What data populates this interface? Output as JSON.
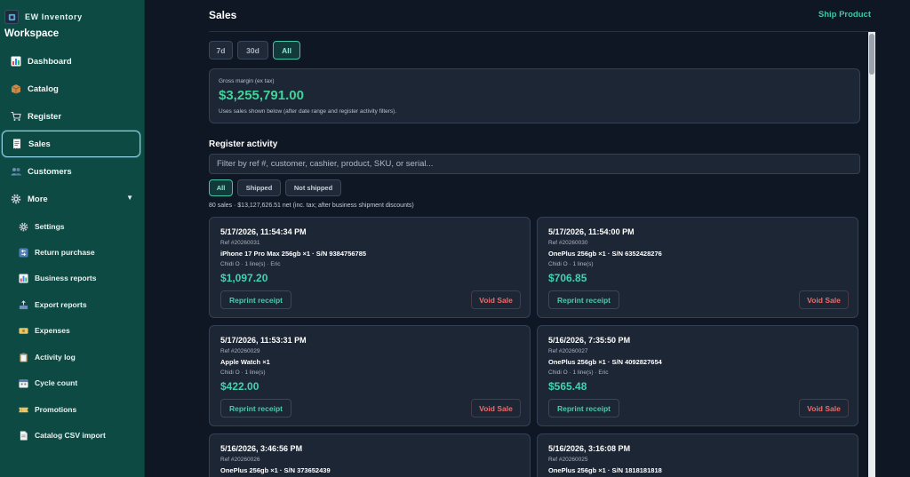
{
  "brand": {
    "name": "EW Inventory",
    "workspace": "Workspace"
  },
  "sidebar": {
    "items": [
      {
        "label": "Dashboard",
        "icon": "chart-icon"
      },
      {
        "label": "Catalog",
        "icon": "box-icon"
      },
      {
        "label": "Register",
        "icon": "cart-icon"
      },
      {
        "label": "Sales",
        "icon": "receipt-icon",
        "active": true
      },
      {
        "label": "Customers",
        "icon": "users-icon"
      },
      {
        "label": "More",
        "icon": "gear-icon",
        "expanded": true
      }
    ],
    "more_items": [
      {
        "label": "Settings",
        "icon": "gear-icon"
      },
      {
        "label": "Return purchase",
        "icon": "return-icon"
      },
      {
        "label": "Business reports",
        "icon": "bar-chart-icon"
      },
      {
        "label": "Export reports",
        "icon": "outbox-icon"
      },
      {
        "label": "Expenses",
        "icon": "money-icon"
      },
      {
        "label": "Activity log",
        "icon": "clipboard-icon"
      },
      {
        "label": "Cycle count",
        "icon": "calendar-icon"
      },
      {
        "label": "Promotions",
        "icon": "ticket-icon"
      },
      {
        "label": "Catalog CSV import",
        "icon": "document-icon"
      }
    ],
    "caret": "▼"
  },
  "header": {
    "title": "Sales",
    "ship_label": "Ship Product"
  },
  "range": {
    "options": [
      "7d",
      "30d",
      "All"
    ],
    "selected": "All"
  },
  "gross_margin": {
    "label": "Gross margin (ex tax)",
    "value": "$3,255,791.00",
    "note": "Uses sales shown below (after date range and register activity filters)."
  },
  "register": {
    "title": "Register activity",
    "filter_placeholder": "Filter by ref #, customer, cashier, product, SKU, or serial...",
    "chips": [
      "All",
      "Shipped",
      "Not shipped"
    ],
    "selected_chip": "All",
    "summary": "80 sales · $13,127,626.51 net (inc. tax; after business shipment discounts)"
  },
  "sales": [
    {
      "datetime": "5/17/2026, 11:54:34 PM",
      "ref": "Ref #20260031",
      "items": "iPhone 17 Pro Max 256gb ×1 · S/N 9384756785",
      "meta": "Chidi O · 1 line(s) · Eric",
      "amount": "$1,097.20",
      "reprint": "Reprint receipt",
      "void": "Void Sale"
    },
    {
      "datetime": "5/17/2026, 11:54:00 PM",
      "ref": "Ref #20260030",
      "items": "OnePlus 256gb ×1 · S/N 6352428276",
      "meta": "Chidi O · 1 line(s)",
      "amount": "$706.85",
      "reprint": "Reprint receipt",
      "void": "Void Sale"
    },
    {
      "datetime": "5/17/2026, 11:53:31 PM",
      "ref": "Ref #20260029",
      "items": "Apple Watch ×1",
      "meta": "Chidi O · 1 line(s)",
      "amount": "$422.00",
      "reprint": "Reprint receipt",
      "void": "Void Sale"
    },
    {
      "datetime": "5/16/2026, 7:35:50 PM",
      "ref": "Ref #20260027",
      "items": "OnePlus 256gb ×1 · S/N 4092827654",
      "meta": "Chidi O · 1 line(s) · Eric",
      "amount": "$565.48",
      "reprint": "Reprint receipt",
      "void": "Void Sale"
    },
    {
      "datetime": "5/16/2026, 3:46:56 PM",
      "ref": "Ref #20260026",
      "items": "OnePlus 256gb ×1 · S/N 373652439",
      "meta": "",
      "amount": "",
      "reprint": "",
      "void": ""
    },
    {
      "datetime": "5/16/2026, 3:16:08 PM",
      "ref": "Ref #20260025",
      "items": "OnePlus 256gb ×1 · S/N 1818181818",
      "meta": "",
      "amount": "",
      "reprint": "",
      "void": ""
    }
  ],
  "colors": {
    "sidebar_bg": "#0e4a44",
    "accent": "#3fc6a8",
    "money": "#3fd39a",
    "danger": "#ef6b6b",
    "page_bg": "#0f1624"
  }
}
